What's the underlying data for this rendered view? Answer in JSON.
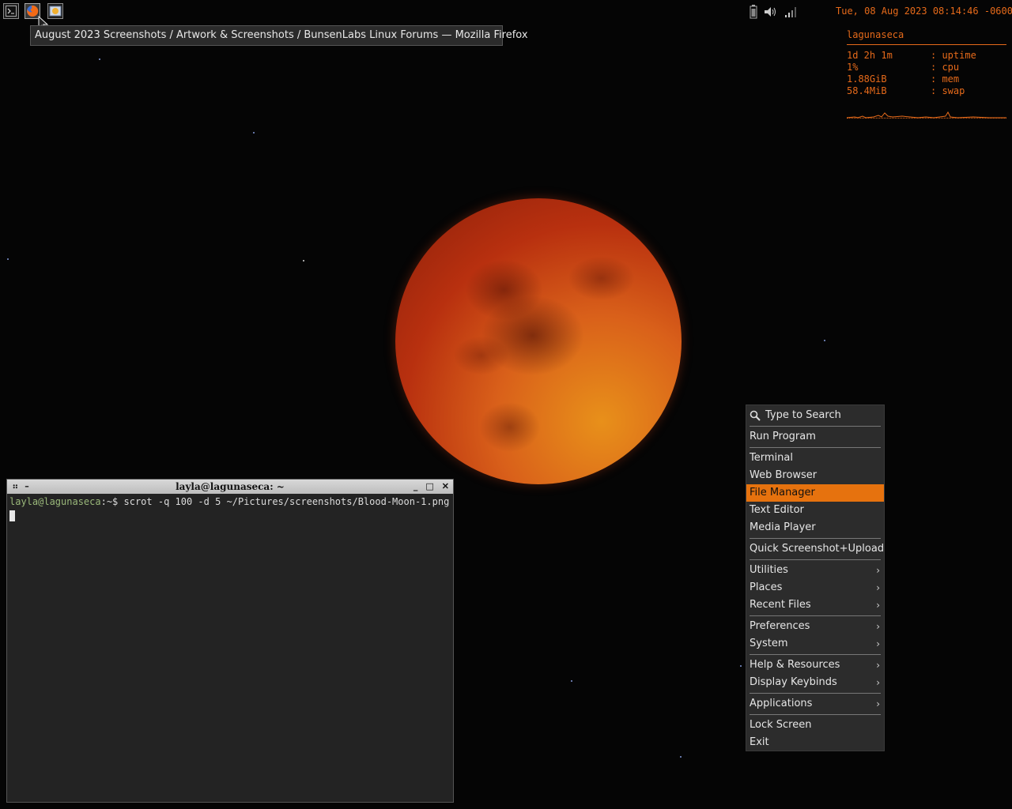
{
  "taskbar": {
    "tooltip": "August 2023 Screenshots / Artwork & Screenshots / BunsenLabs Linux Forums — Mozilla Firefox",
    "clock": "Tue, 08 Aug 2023 08:14:46 -0600"
  },
  "conky": {
    "hostname": "lagunaseca",
    "rows": [
      {
        "value": "1d 2h 1m",
        "label": ": uptime"
      },
      {
        "value": "1%",
        "label": ": cpu"
      },
      {
        "value": "1.88GiB",
        "label": ": mem"
      },
      {
        "value": "58.4MiB",
        "label": ": swap"
      }
    ]
  },
  "terminal": {
    "title": "layla@lagunaseca: ~",
    "prompt_user": "layla@lagunaseca",
    "prompt_rest": ":~$ scrot -q 100 -d 5 ~/Pictures/screenshots/Blood-Moon-1.png"
  },
  "menu": {
    "search": "Type to Search",
    "run_program": "Run Program",
    "terminal": "Terminal",
    "web_browser": "Web Browser",
    "file_manager": "File Manager",
    "text_editor": "Text Editor",
    "media_player": "Media Player",
    "quick_screenshot": "Quick Screenshot+Upload",
    "utilities": "Utilities",
    "places": "Places",
    "recent_files": "Recent Files",
    "preferences": "Preferences",
    "system": "System",
    "help_resources": "Help & Resources",
    "display_keybinds": "Display Keybinds",
    "applications": "Applications",
    "lock_screen": "Lock Screen",
    "exit": "Exit",
    "arrow": "›"
  },
  "colors": {
    "accent": "#e6720e",
    "conky": "#e66a1a",
    "desktop": "#050505"
  }
}
